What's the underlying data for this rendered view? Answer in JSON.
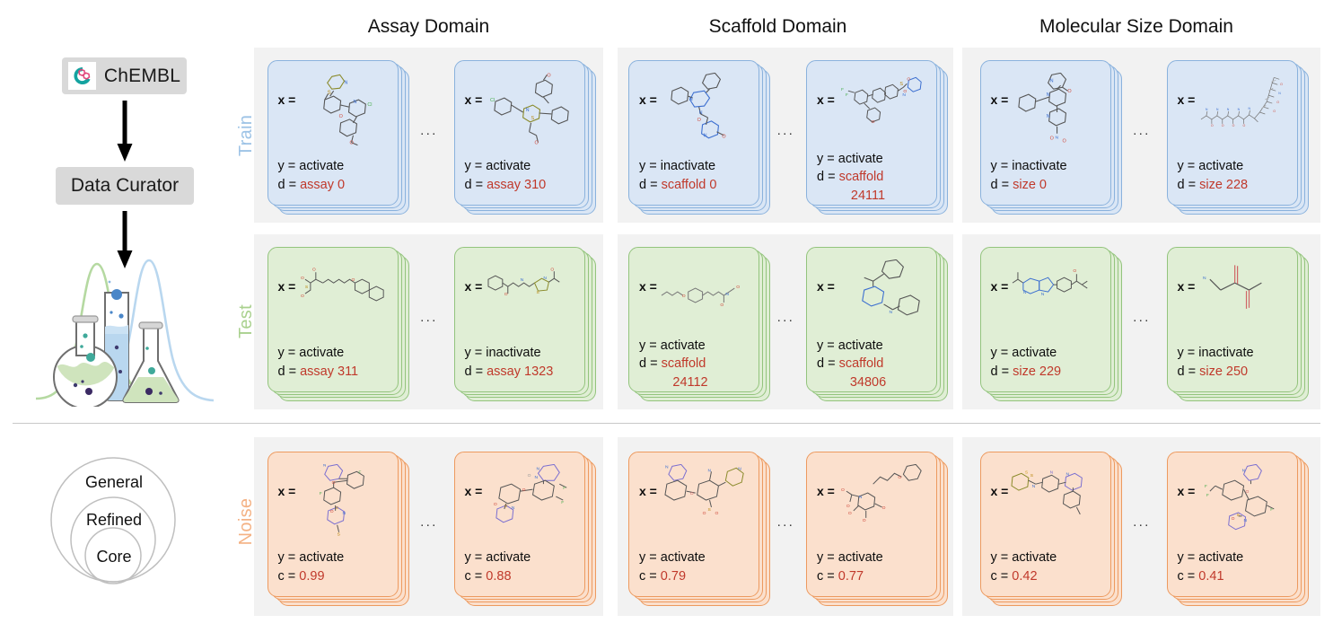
{
  "pipeline": {
    "source_label": "ChEMBL",
    "curator_label": "Data Curator",
    "venn": {
      "outer": "General",
      "middle": "Refined",
      "inner": "Core"
    }
  },
  "row_labels": [
    {
      "key": "train",
      "label": "Train",
      "color": "#9dc3e6"
    },
    {
      "key": "test",
      "label": "Test",
      "color": "#a9d18e"
    },
    {
      "key": "noise",
      "label": "Noise",
      "color": "#f4b183"
    }
  ],
  "columns": [
    {
      "key": "assay",
      "header": "Assay Domain"
    },
    {
      "key": "scaffold",
      "header": "Scaffold Domain"
    },
    {
      "key": "size",
      "header": "Molecular Size Domain"
    }
  ],
  "ellipsis": "···",
  "x_label": "x =",
  "colors": {
    "train_fill": "#dae6f5",
    "train_stroke": "#8ab2dd",
    "test_fill": "#e0eed5",
    "test_stroke": "#93c47d",
    "noise_fill": "#fbe0cd",
    "noise_stroke": "#ed9a5f",
    "panel_bg": "#f2f2f2",
    "value_red": "#c0392b",
    "chip_bg": "#d9d9d9"
  },
  "cards": {
    "assay": {
      "train": [
        {
          "y_line": "y = activate",
          "d_prefix": "d = ",
          "d_value": "assay 0",
          "d_value2": ""
        },
        {
          "y_line": "y = activate",
          "d_prefix": "d = ",
          "d_value": "assay 310",
          "d_value2": ""
        }
      ],
      "test": [
        {
          "y_line": "y = activate",
          "d_prefix": "d = ",
          "d_value": "assay 311",
          "d_value2": ""
        },
        {
          "y_line": "y = inactivate",
          "d_prefix": "d = ",
          "d_value": "assay 1323",
          "d_value2": ""
        }
      ],
      "noise": [
        {
          "y_line": "y = activate",
          "d_prefix": "c = ",
          "d_value": "0.99",
          "d_value2": ""
        },
        {
          "y_line": "y = activate",
          "d_prefix": "c = ",
          "d_value": "0.88",
          "d_value2": ""
        }
      ]
    },
    "scaffold": {
      "train": [
        {
          "y_line": "y = inactivate",
          "d_prefix": "d = ",
          "d_value": "scaffold 0",
          "d_value2": ""
        },
        {
          "y_line": "y = activate",
          "d_prefix": "d = ",
          "d_value": "scaffold",
          "d_value2": "24111"
        }
      ],
      "test": [
        {
          "y_line": "y = activate",
          "d_prefix": "d = ",
          "d_value": "scaffold",
          "d_value2": "24112"
        },
        {
          "y_line": "y = activate",
          "d_prefix": "d = ",
          "d_value": "scaffold",
          "d_value2": "34806"
        }
      ],
      "noise": [
        {
          "y_line": "y = activate",
          "d_prefix": "c = ",
          "d_value": "0.79",
          "d_value2": ""
        },
        {
          "y_line": "y = activate",
          "d_prefix": "c = ",
          "d_value": "0.77",
          "d_value2": ""
        }
      ]
    },
    "size": {
      "train": [
        {
          "y_line": "y = inactivate",
          "d_prefix": "d = ",
          "d_value": "size 0",
          "d_value2": ""
        },
        {
          "y_line": "y = activate",
          "d_prefix": "d = ",
          "d_value": "size 228",
          "d_value2": ""
        }
      ],
      "test": [
        {
          "y_line": "y = activate",
          "d_prefix": "d = ",
          "d_value": "size 229",
          "d_value2": ""
        },
        {
          "y_line": "y = inactivate",
          "d_prefix": "d = ",
          "d_value": "size 250",
          "d_value2": ""
        }
      ],
      "noise": [
        {
          "y_line": "y = activate",
          "d_prefix": "c = ",
          "d_value": "0.42",
          "d_value2": ""
        },
        {
          "y_line": "y = activate",
          "d_prefix": "c = ",
          "d_value": "0.41",
          "d_value2": ""
        }
      ]
    }
  }
}
